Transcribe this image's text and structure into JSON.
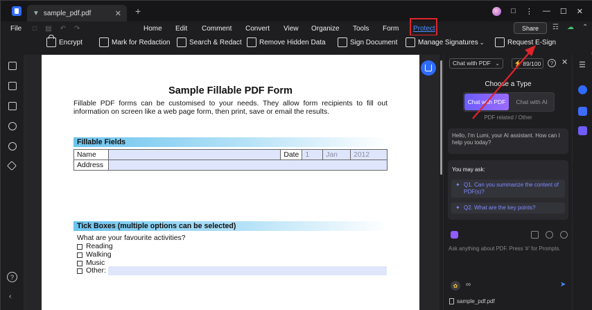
{
  "titlebar": {
    "tab_title": "sample_pdf.pdf",
    "close": "✕",
    "new_tab": "+"
  },
  "window": {
    "minimize": "—",
    "maximize": "☐",
    "close": "✕"
  },
  "menubar": {
    "file": "File",
    "menus": [
      "Home",
      "Edit",
      "Comment",
      "Convert",
      "View",
      "Organize",
      "Tools",
      "Form",
      "Protect"
    ],
    "active": "Protect",
    "share": "Share"
  },
  "toolbar": {
    "encrypt": "Encrypt",
    "mark_redaction": "Mark for Redaction",
    "search_redact": "Search & Redact",
    "remove_hidden": "Remove Hidden Data",
    "sign_document": "Sign Document",
    "manage_signatures": "Manage Signatures",
    "request_esign": "Request E-Sign"
  },
  "document": {
    "title": "Sample Fillable PDF Form",
    "intro": "Fillable PDF forms can be customised to your needs. They allow form recipients to fill out information on screen like a web page form, then print, save or email the results.",
    "fillable_header": "Fillable Fields",
    "name_label": "Name",
    "date_label": "Date",
    "date_day": "1",
    "date_month": "Jan",
    "date_year": "2012",
    "address_label": "Address",
    "tick_header": "Tick Boxes (multiple options can be selected)",
    "tick_question": "What are your favourite activities?",
    "options": [
      "Reading",
      "Walking",
      "Music",
      "Other:"
    ]
  },
  "panel": {
    "model": "Chat with PDF",
    "tokens": "89/100",
    "choose_type": "Choose a Type",
    "type_pdf": "Chat with PDF",
    "type_ai": "Chat with AI",
    "related": "PDF related / Other",
    "greeting": "Hello, I'm Lumi, your AI assistant. How can I help you today?",
    "ask_title": "You may ask:",
    "q1": "Q1. Can you summarize the content of PDF(s)?",
    "q2": "Q2. What are the key points?",
    "placeholder": "Ask anything about PDF. Press '#' for Prompts.",
    "file": "sample_pdf.pdf"
  },
  "colors": {
    "accent": "#2f6bff",
    "highlight": "#e0242a",
    "field": "#dfe6fb"
  }
}
